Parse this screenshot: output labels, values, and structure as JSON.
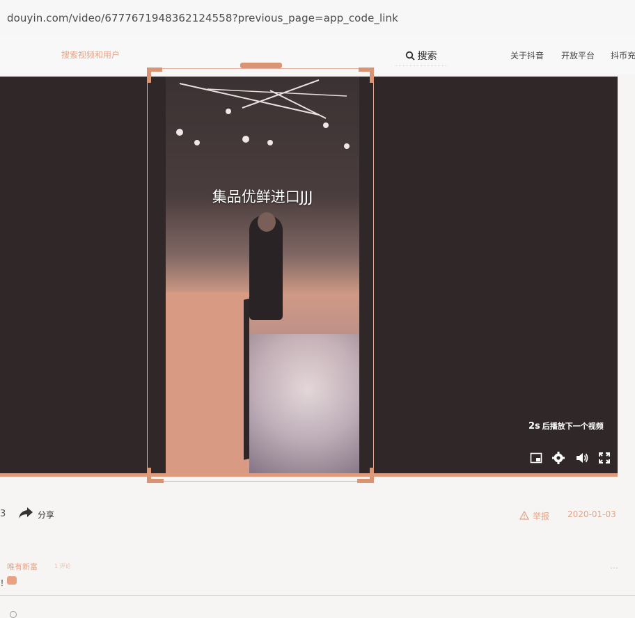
{
  "browser": {
    "url": "douyin.com/video/6777671948362124558?previous_page=app_code_link"
  },
  "nav": {
    "promo_text": "搜索视频和用户",
    "search_label": "搜索",
    "links": [
      "关于抖音",
      "开放平台",
      "抖币充值"
    ]
  },
  "video": {
    "caption": "集品优鲜进口JJJ",
    "next_seconds": "2s",
    "next_text": "后播放下一个视频",
    "progress_fraction": 1.0
  },
  "controls": {
    "icons": [
      "picture-in-picture-icon",
      "settings-icon",
      "volume-icon",
      "fullscreen-icon"
    ]
  },
  "actions": {
    "like_count": "3",
    "share_label": "分享",
    "report_label": "举报",
    "date": "2020-01-03"
  },
  "comment": {
    "author": "唯有新富",
    "meta": "1 评论",
    "text": "！"
  },
  "colors": {
    "accent": "#df9b7e",
    "player_bg": "#302828",
    "page_bg": "#f6f5f4"
  }
}
